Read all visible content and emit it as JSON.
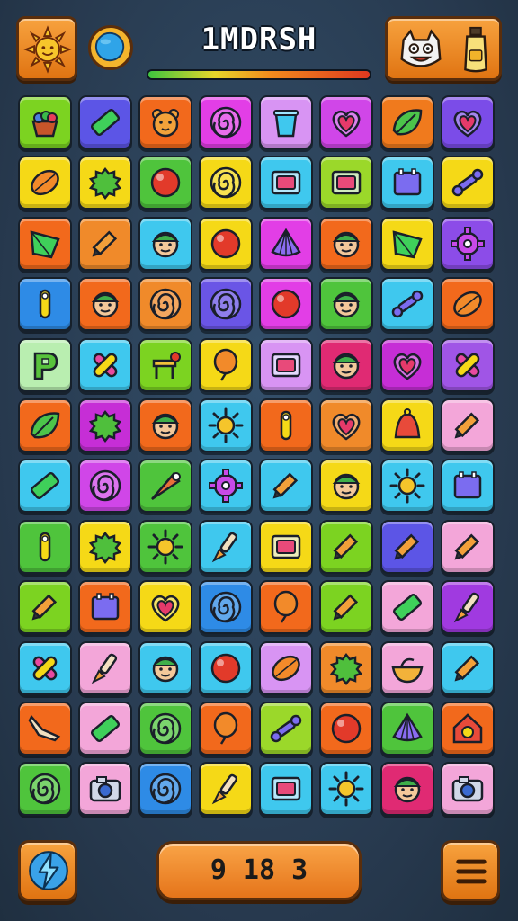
{
  "header": {
    "title": "1MDRSH",
    "progress": 1.0,
    "left_button_icon": "sun-icon",
    "center_left_icon": "globe-icon",
    "right_button_icons": [
      "creature-icon",
      "potion-bottle-icon"
    ]
  },
  "board": {
    "columns": 8,
    "rows": 12,
    "tiles": [
      [
        {
          "c": "#7cd321",
          "i": "basket"
        },
        {
          "c": "#5c55e6",
          "i": "eraser"
        },
        {
          "c": "#f2691c",
          "i": "bear"
        },
        {
          "c": "#e23ee6",
          "i": "spiral"
        },
        {
          "c": "#d894f3",
          "i": "cup"
        },
        {
          "c": "#d046e8",
          "i": "heart"
        },
        {
          "c": "#f07a1d",
          "i": "leaf"
        },
        {
          "c": "#7b4ce8",
          "i": "heart"
        }
      ],
      [
        {
          "c": "#f5d917",
          "i": "lemon"
        },
        {
          "c": "#f5d917",
          "i": "bush"
        },
        {
          "c": "#4fc43c",
          "i": "ball"
        },
        {
          "c": "#f5d917",
          "i": "spiral"
        },
        {
          "c": "#3fc8ee",
          "i": "card"
        },
        {
          "c": "#9bd82a",
          "i": "card"
        },
        {
          "c": "#3fc8ee",
          "i": "box"
        },
        {
          "c": "#f5d917",
          "i": "bone"
        }
      ],
      [
        {
          "c": "#f2691c",
          "i": "gem"
        },
        {
          "c": "#f08a2a",
          "i": "pencil"
        },
        {
          "c": "#3fc8ee",
          "i": "face"
        },
        {
          "c": "#f5d917",
          "i": "ball"
        },
        {
          "c": "#e23ee6",
          "i": "shell"
        },
        {
          "c": "#f2691c",
          "i": "face"
        },
        {
          "c": "#f5d917",
          "i": "gem"
        },
        {
          "c": "#8c4ce8",
          "i": "gear"
        }
      ],
      [
        {
          "c": "#2e8be6",
          "i": "pin"
        },
        {
          "c": "#f2691c",
          "i": "face"
        },
        {
          "c": "#f08a2a",
          "i": "spiral"
        },
        {
          "c": "#6a55e6",
          "i": "spiral"
        },
        {
          "c": "#e23ee6",
          "i": "ball"
        },
        {
          "c": "#4fc43c",
          "i": "face"
        },
        {
          "c": "#3fc8ee",
          "i": "bone"
        },
        {
          "c": "#f2691c",
          "i": "lemon"
        }
      ],
      [
        {
          "c": "#b9eeb0",
          "i": "letter"
        },
        {
          "c": "#3fc8ee",
          "i": "cross"
        },
        {
          "c": "#7cd321",
          "i": "chair"
        },
        {
          "c": "#f5d917",
          "i": "balloon"
        },
        {
          "c": "#d894f3",
          "i": "card"
        },
        {
          "c": "#e02a73",
          "i": "face"
        },
        {
          "c": "#c62ed6",
          "i": "heart"
        },
        {
          "c": "#a055e6",
          "i": "cross"
        }
      ],
      [
        {
          "c": "#f2691c",
          "i": "leaf"
        },
        {
          "c": "#c62ed6",
          "i": "bush"
        },
        {
          "c": "#f2691c",
          "i": "face"
        },
        {
          "c": "#3fc8ee",
          "i": "sun"
        },
        {
          "c": "#f2691c",
          "i": "pin"
        },
        {
          "c": "#f08a2a",
          "i": "heart"
        },
        {
          "c": "#f5d917",
          "i": "bell"
        },
        {
          "c": "#f3a6d9",
          "i": "pencil"
        }
      ],
      [
        {
          "c": "#3fc8ee",
          "i": "eraser"
        },
        {
          "c": "#d046e8",
          "i": "spiral"
        },
        {
          "c": "#4fc43c",
          "i": "cone"
        },
        {
          "c": "#3fc8ee",
          "i": "gear"
        },
        {
          "c": "#3fc8ee",
          "i": "pencil"
        },
        {
          "c": "#f5d917",
          "i": "face"
        },
        {
          "c": "#3fc8ee",
          "i": "sun"
        },
        {
          "c": "#3fc8ee",
          "i": "box"
        }
      ],
      [
        {
          "c": "#4fc43c",
          "i": "pin"
        },
        {
          "c": "#f5d917",
          "i": "bush"
        },
        {
          "c": "#4fc43c",
          "i": "sun"
        },
        {
          "c": "#3fc8ee",
          "i": "brush"
        },
        {
          "c": "#f5d917",
          "i": "card"
        },
        {
          "c": "#7cd321",
          "i": "pencil"
        },
        {
          "c": "#5c55e6",
          "i": "pencil"
        },
        {
          "c": "#f3a6d9",
          "i": "pencil"
        }
      ],
      [
        {
          "c": "#7cd321",
          "i": "pencil"
        },
        {
          "c": "#f2691c",
          "i": "box"
        },
        {
          "c": "#f5d917",
          "i": "heart"
        },
        {
          "c": "#2e8be6",
          "i": "spiral"
        },
        {
          "c": "#f2691c",
          "i": "balloon"
        },
        {
          "c": "#7cd321",
          "i": "pencil"
        },
        {
          "c": "#f3a6d9",
          "i": "eraser"
        },
        {
          "c": "#a03ae0",
          "i": "brush"
        }
      ],
      [
        {
          "c": "#3fc8ee",
          "i": "cross"
        },
        {
          "c": "#f3a6d9",
          "i": "brush"
        },
        {
          "c": "#3fc8ee",
          "i": "face"
        },
        {
          "c": "#3fc8ee",
          "i": "ball"
        },
        {
          "c": "#d894f3",
          "i": "lemon"
        },
        {
          "c": "#f08a2a",
          "i": "bush"
        },
        {
          "c": "#f3a6d9",
          "i": "bowl"
        },
        {
          "c": "#3fc8ee",
          "i": "pencil"
        }
      ],
      [
        {
          "c": "#f2691c",
          "i": "boomerang"
        },
        {
          "c": "#f3a6d9",
          "i": "eraser"
        },
        {
          "c": "#4fc43c",
          "i": "spiral"
        },
        {
          "c": "#f2691c",
          "i": "balloon"
        },
        {
          "c": "#9bd82a",
          "i": "bone"
        },
        {
          "c": "#f2691c",
          "i": "ball"
        },
        {
          "c": "#4fc43c",
          "i": "shell"
        },
        {
          "c": "#f2691c",
          "i": "house"
        }
      ],
      [
        {
          "c": "#4fc43c",
          "i": "spiral"
        },
        {
          "c": "#f3a6d9",
          "i": "camera"
        },
        {
          "c": "#2e8be6",
          "i": "spiral"
        },
        {
          "c": "#f5d917",
          "i": "brush"
        },
        {
          "c": "#3fc8ee",
          "i": "card"
        },
        {
          "c": "#3fc8ee",
          "i": "sun"
        },
        {
          "c": "#e02a73",
          "i": "face"
        },
        {
          "c": "#f3a6d9",
          "i": "camera"
        }
      ]
    ]
  },
  "footer": {
    "score": "9 18 3",
    "left_button_icon": "lightning-icon",
    "right_button_icon": "menu-icon"
  }
}
